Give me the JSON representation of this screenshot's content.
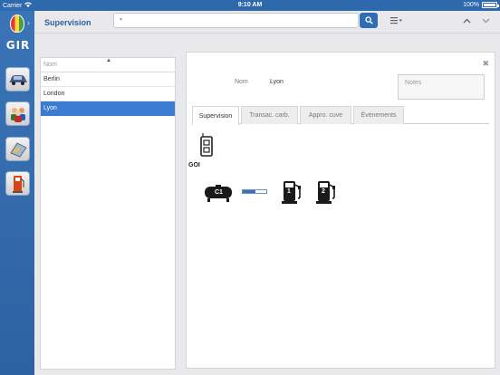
{
  "status": {
    "carrier": "Carrier",
    "time": "9:10 AM",
    "battery": "100%"
  },
  "brand": {
    "logo_text": "GIR"
  },
  "rail": {
    "items": [
      {
        "icon": "car-icon"
      },
      {
        "icon": "users-icon"
      },
      {
        "icon": "card-reader-icon"
      },
      {
        "icon": "fuel-pump-icon"
      }
    ]
  },
  "header": {
    "title": "Supervision",
    "search_value": "",
    "search_placeholder": ""
  },
  "list": {
    "column": "Nom",
    "items": [
      "Berlin",
      "London",
      "Lyon"
    ],
    "selected": "Lyon"
  },
  "detail": {
    "name_label": "Nom",
    "name_value": "Lyon",
    "notes_placeholder": "Notes",
    "tabs": [
      {
        "label": "Supervision",
        "active": true
      },
      {
        "label": "Transac. carb.",
        "active": false
      },
      {
        "label": "Appro. cuve",
        "active": false
      },
      {
        "label": "Événements",
        "active": false
      }
    ],
    "device_label": "GOI",
    "tank_label": "C1",
    "tank_level": 0.55,
    "pumps": [
      "1",
      "2"
    ]
  },
  "colors": {
    "accent": "#2e69ad",
    "selection": "#3b7bd0"
  }
}
